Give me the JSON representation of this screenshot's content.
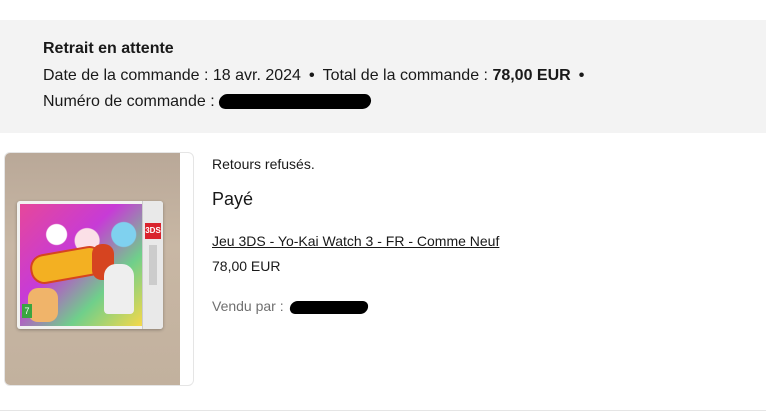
{
  "order": {
    "status_title": "Retrait en attente",
    "date_label": "Date de la commande : ",
    "date_value": "18 avr. 2024",
    "separator": "•",
    "total_label": "Total de la commande : ",
    "total_value": "78,00 EUR",
    "number_label": "Numéro de commande :"
  },
  "item": {
    "returns_policy": "Retours refusés.",
    "payment_status": "Payé",
    "title": "Jeu 3DS - Yo-Kai Watch 3 - FR - Comme Neuf",
    "price": "78,00 EUR",
    "seller_label": "Vendu par :"
  }
}
